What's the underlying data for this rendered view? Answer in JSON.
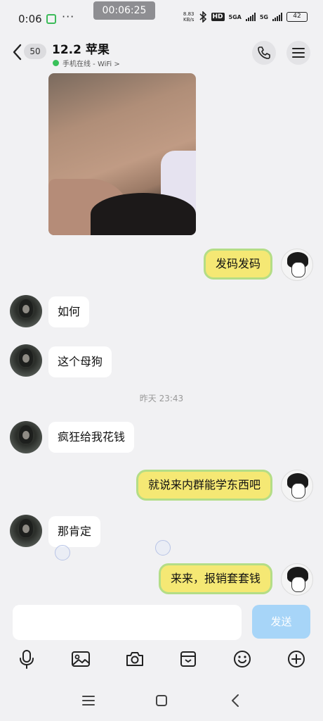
{
  "status_bar": {
    "time": "0:06",
    "timer": "00:06:25",
    "speed_value": "8.83",
    "speed_unit": "KB/s",
    "hd": "HD",
    "net1": "5GA",
    "net2": "5G",
    "battery": "42"
  },
  "header": {
    "unread_count": "50",
    "title": "12.2 苹果",
    "status": "手机在线 - WiFi >"
  },
  "messages": [
    {
      "side": "out",
      "text": "发码发码"
    },
    {
      "side": "in",
      "text": "如何"
    },
    {
      "side": "in",
      "text": "这个母狗"
    },
    {
      "side": "in",
      "text": "疯狂给我花钱"
    },
    {
      "side": "out",
      "text": "就说来内群能学东西吧"
    },
    {
      "side": "in",
      "text": "那肯定"
    },
    {
      "side": "out",
      "text": "来来，报销套套钱"
    }
  ],
  "timestamp": "昨天 23:43",
  "input": {
    "placeholder": "",
    "send_label": "发送"
  },
  "colors": {
    "accent_send": "#a7d5f8",
    "out_bubble": "#f5e874",
    "out_border": "#b4dd86",
    "online": "#39c15a"
  },
  "icons": [
    "back-icon",
    "phone-icon",
    "menu-icon",
    "mic-icon",
    "image-icon",
    "camera-icon",
    "wallet-icon",
    "emoji-icon",
    "plus-icon",
    "nav-recents-icon",
    "nav-home-icon",
    "nav-back-icon"
  ]
}
